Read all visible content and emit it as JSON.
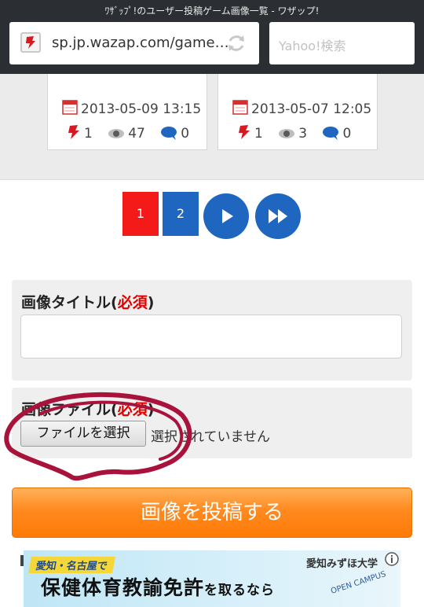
{
  "browser": {
    "window_title": "ﾜｻﾞｯﾌﾟ!のユーザー投稿ゲーム画像一覧 - ワザップ!",
    "url": "sp.jp.wazap.com/game…",
    "search_placeholder": "Yahoo!検索",
    "icons": [
      "site-favicon",
      "reload-icon"
    ]
  },
  "posts": [
    {
      "date": "2013-05-09 13:15",
      "likes": "1",
      "views": "47",
      "comments": "0"
    },
    {
      "date": "2013-05-07 12:05",
      "likes": "1",
      "views": "3",
      "comments": "0"
    }
  ],
  "pagination": {
    "pages": [
      "1",
      "2"
    ],
    "current": "1",
    "icons": [
      "next-icon",
      "last-icon"
    ],
    "colors": {
      "current": "#f51a1a",
      "other": "#1e66c0"
    }
  },
  "form": {
    "title_label": "画像タイトル(",
    "title_required": "必須",
    "title_close": ")",
    "title_value": "",
    "file_label": "画像ファイル(",
    "file_required": "必須",
    "file_close": ")",
    "file_button": "ファイルを選択",
    "file_status": "選択されていません",
    "submit": "画像を投稿する",
    "colors": {
      "submit": "#ff8a1f",
      "required": "#e00000"
    }
  },
  "ad": {
    "tag": "愛知・名古屋で",
    "headline": "保健体育教諭免許",
    "headline_suffix": "を取るなら",
    "university": "愛知みずほ大学",
    "campus": "OPEN CAMPUS"
  }
}
